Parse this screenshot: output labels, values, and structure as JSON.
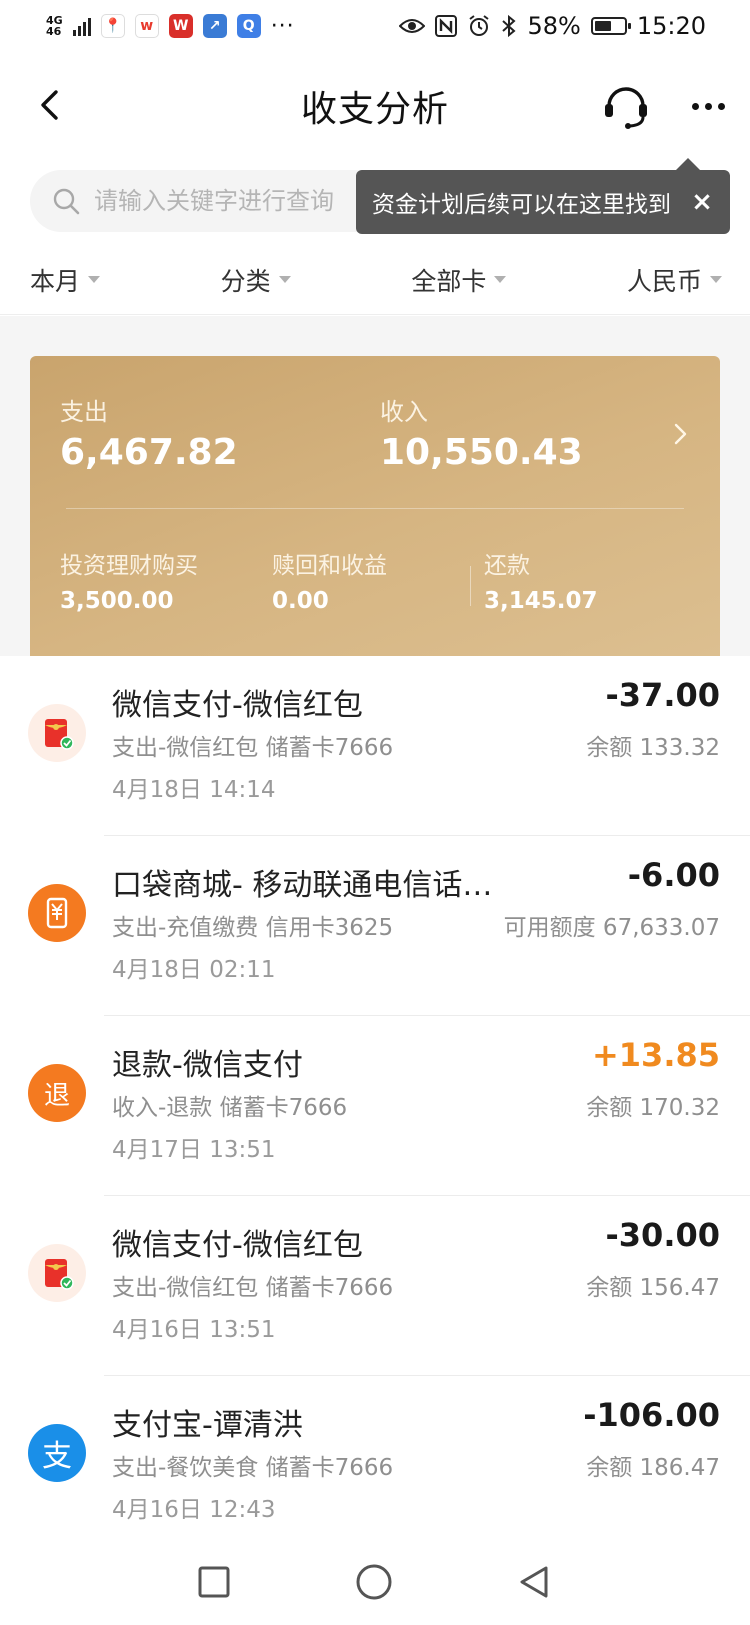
{
  "status_bar": {
    "network": "4G",
    "signal_sub": "46",
    "apps": [
      {
        "icon": "location-pin-app-icon",
        "glyph": "♥",
        "color": "#e8473b"
      },
      {
        "icon": "wps-office-app-icon",
        "glyph": "W",
        "color": "#e83a2e"
      },
      {
        "icon": "wps-writer-app-icon",
        "glyph": "W",
        "color": "#d92f2a"
      },
      {
        "icon": "chart-app-icon",
        "glyph": "↗",
        "color": "#3a7bd5"
      },
      {
        "icon": "browser-app-icon",
        "glyph": "Q",
        "color": "#3f7fe6"
      }
    ],
    "more": "···",
    "battery": "58%",
    "battery_level": 0.58,
    "time": "15:20"
  },
  "nav": {
    "title": "收支分析"
  },
  "search": {
    "placeholder": "请输入关键字进行查询"
  },
  "tooltip": {
    "text": "资金计划后续可以在这里找到",
    "close": "×"
  },
  "filters": [
    {
      "label": "本月"
    },
    {
      "label": "分类"
    },
    {
      "label": "全部卡"
    },
    {
      "label": "人民币"
    }
  ],
  "summary": {
    "expense_label": "支出",
    "expense_value": "6,467.82",
    "income_label": "收入",
    "income_value": "10,550.43",
    "invest_label": "投资理财购买",
    "invest_value": "3,500.00",
    "redeem_label": "赎回和收益",
    "redeem_value": "0.00",
    "repay_label": "还款",
    "repay_value": "3,145.07"
  },
  "transactions": [
    {
      "icon": "red-packet-icon",
      "title": "微信支付-微信红包",
      "sub": "支出-微信红包 储蓄卡7666",
      "date": "4月18日 14:14",
      "amount": "-37.00",
      "type": "expense",
      "balance": "余额 133.32"
    },
    {
      "icon": "mobile-topup-icon",
      "title": "口袋商城- 移动联通电信话…",
      "sub": "支出-充值缴费 信用卡3625",
      "date": "4月18日 02:11",
      "amount": "-6.00",
      "type": "expense",
      "balance": "可用额度 67,633.07"
    },
    {
      "icon": "refund-icon",
      "title": "退款-微信支付",
      "sub": "收入-退款 储蓄卡7666",
      "date": "4月17日 13:51",
      "amount": "+13.85",
      "type": "income",
      "balance": "余额 170.32",
      "icon_text": "退"
    },
    {
      "icon": "red-packet-icon",
      "title": "微信支付-微信红包",
      "sub": "支出-微信红包 储蓄卡7666",
      "date": "4月16日 13:51",
      "amount": "-30.00",
      "type": "expense",
      "balance": "余额 156.47"
    },
    {
      "icon": "alipay-icon",
      "title": "支付宝-谭清洪",
      "sub": "支出-餐饮美食 储蓄卡7666",
      "date": "4月16日 12:43",
      "amount": "-106.00",
      "type": "expense",
      "balance": "余额 186.47",
      "icon_text": "支"
    }
  ],
  "colors": {
    "income": "#f08a1f",
    "summary_gold": "#d2b07c",
    "tooltip_bg": "#555555"
  }
}
